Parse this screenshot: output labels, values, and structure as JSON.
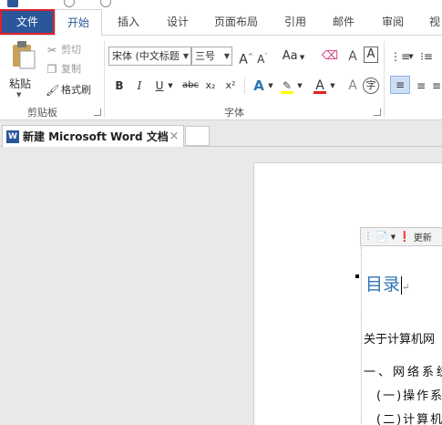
{
  "tabs": {
    "file": "文件",
    "home": "开始",
    "insert": "插入",
    "design": "设计",
    "layout": "页面布局",
    "references": "引用",
    "mailings": "邮件",
    "review": "审阅",
    "view": "视"
  },
  "clipboard": {
    "paste": "粘贴",
    "cut": "剪切",
    "copy": "复制",
    "format_painter": "格式刷",
    "group": "剪贴板"
  },
  "font": {
    "name": "宋体 (中文标题",
    "size": "三号",
    "bold": "B",
    "italic": "I",
    "underline": "U",
    "strike": "abc",
    "subscript": "x₂",
    "superscript": "x²",
    "group": "字体",
    "case_label": "Aa",
    "grow": "A",
    "shrink": "A",
    "clear": "A",
    "highlight_color": "#ffff00",
    "font_color": "#e02020"
  },
  "doc": {
    "tab_title": "新建 Microsoft Word 文档",
    "close": "×",
    "minitoolbar_label": "更新",
    "heading": "目录",
    "para_marker": "↵",
    "lines": [
      "关于计算机网",
      "一、网络系统",
      "(一)操作系",
      "(二)计算机"
    ]
  },
  "colors": {
    "accent": "#2b579a",
    "file_border": "#e0202a",
    "heading": "#2e74b5"
  }
}
